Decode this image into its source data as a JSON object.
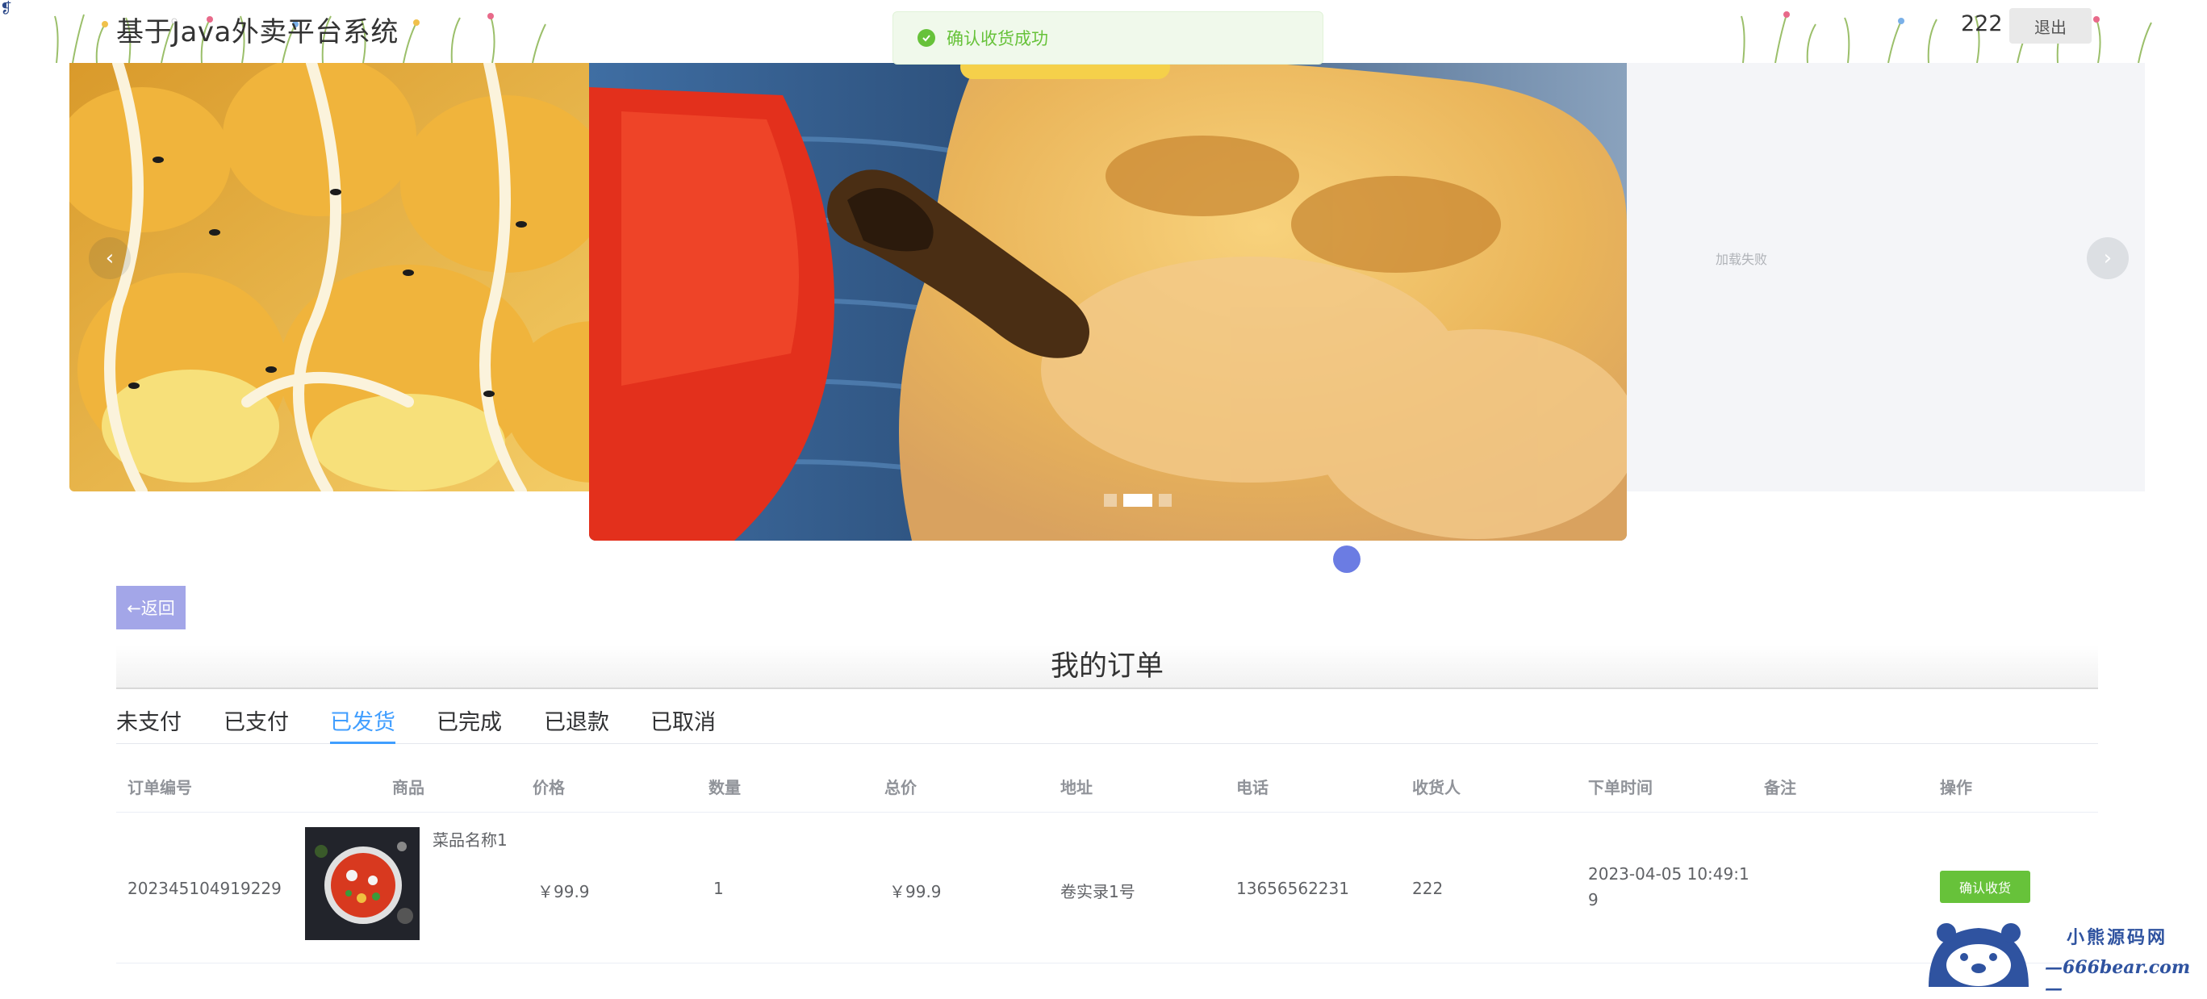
{
  "header": {
    "site_title": "基于Java外卖平台系统",
    "username": "222",
    "logout_label": "退出"
  },
  "toast": {
    "message": "确认收货成功",
    "type": "success"
  },
  "carousel": {
    "load_failed_text": "加载失败",
    "slide_count": 3,
    "active_index": 1
  },
  "back_button": {
    "label": "←返回"
  },
  "page_title": "我的订单",
  "tabs": [
    {
      "label": "未支付"
    },
    {
      "label": "已支付"
    },
    {
      "label": "已发货",
      "active": true
    },
    {
      "label": "已完成"
    },
    {
      "label": "已退款"
    },
    {
      "label": "已取消"
    }
  ],
  "table": {
    "headers": [
      "订单编号",
      "商品",
      "价格",
      "数量",
      "总价",
      "地址",
      "电话",
      "收货人",
      "下单时间",
      "备注",
      "操作"
    ],
    "rows": [
      {
        "order_no": "202345104919229",
        "product_name": "菜品名称1",
        "price": "￥99.9",
        "quantity": "1",
        "total": "￥99.9",
        "address": "卷实录1号",
        "phone": "13656562231",
        "receiver": "222",
        "order_time_line1": "2023-04-05 10:49:1",
        "order_time_line2": "9",
        "remark": "",
        "action_label": "确认收货"
      }
    ]
  },
  "watermark": {
    "cn": "小熊源码网",
    "en": "—666bear.com—"
  },
  "colors": {
    "primary": "#409eff",
    "success": "#67c23a",
    "back_button": "#a3a6e8"
  }
}
